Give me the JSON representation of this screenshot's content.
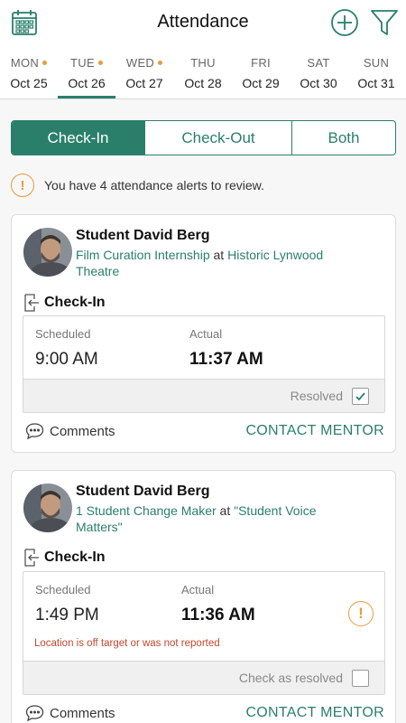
{
  "app": {
    "title": "Attendance",
    "accent_color": "#2a7f6a",
    "warning_color": "#e99a3c",
    "error_color": "#c0492f",
    "icons": {
      "left": "calendar-icon",
      "add": "plus-circle-icon",
      "filter": "filter-icon"
    }
  },
  "days": [
    {
      "dow": "MON",
      "date": "Oct 25",
      "has_dot": true,
      "selected": false
    },
    {
      "dow": "TUE",
      "date": "Oct 26",
      "has_dot": true,
      "selected": true
    },
    {
      "dow": "WED",
      "date": "Oct 27",
      "has_dot": true,
      "selected": false
    },
    {
      "dow": "THU",
      "date": "Oct 28",
      "has_dot": false,
      "selected": false
    },
    {
      "dow": "FRI",
      "date": "Oct 29",
      "has_dot": false,
      "selected": false
    },
    {
      "dow": "SAT",
      "date": "Oct 30",
      "has_dot": false,
      "selected": false
    },
    {
      "dow": "SUN",
      "date": "Oct 31",
      "has_dot": false,
      "selected": false
    }
  ],
  "filter": {
    "options": [
      "Check-In",
      "Check-Out",
      "Both"
    ],
    "selected": "Check-In"
  },
  "alert": {
    "icon": "warning-icon",
    "text": "You have 4 attendance alerts to review."
  },
  "cards": [
    {
      "student": "Student David Berg",
      "position": "Film Curation Internship",
      "at": "at",
      "location": "Historic Lynwood Theatre",
      "type_label": "Check-In",
      "scheduled_label": "Scheduled",
      "actual_label": "Actual",
      "scheduled": "9:00 AM",
      "actual": "11:37 AM",
      "status_label": "Resolved",
      "resolved": true,
      "comments_label": "Comments",
      "contact_label": "CONTACT MENTOR"
    },
    {
      "student": "Student David Berg",
      "position": "1 Student Change Maker",
      "at": "at",
      "location": "\"Student Voice Matters\"",
      "type_label": "Check-In",
      "scheduled_label": "Scheduled",
      "actual_label": "Actual",
      "scheduled": "1:49 PM",
      "actual": "11:36 AM",
      "warning_icon": "!",
      "note": "Location is off target or was not reported",
      "status_label": "Check as resolved",
      "resolved": false,
      "comments_label": "Comments",
      "contact_label": "CONTACT MENTOR"
    }
  ]
}
